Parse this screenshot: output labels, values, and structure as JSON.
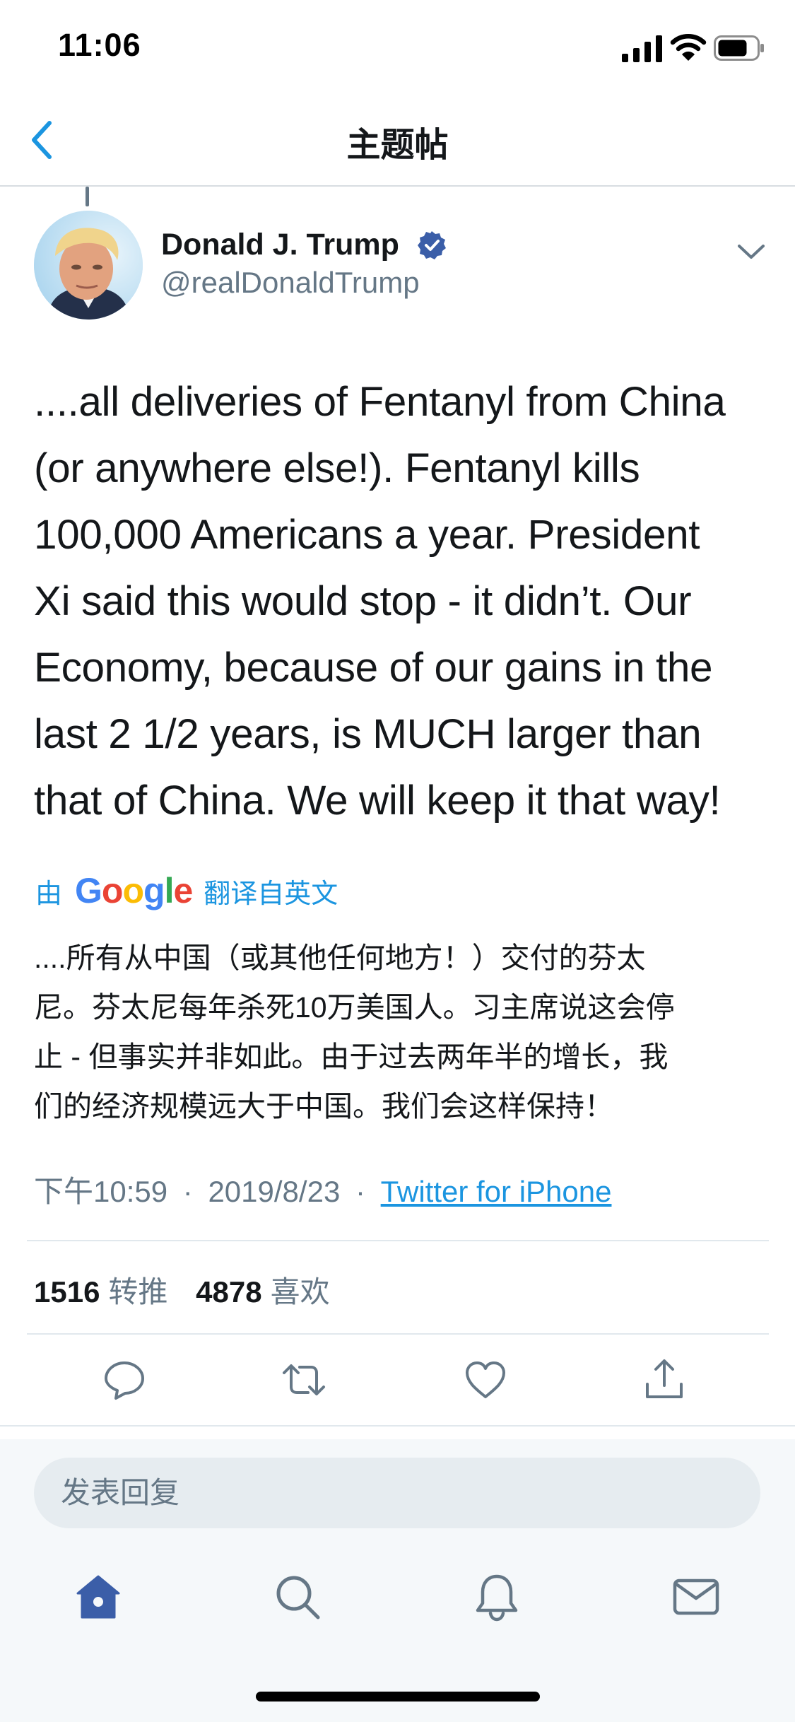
{
  "status_bar": {
    "time": "11:06"
  },
  "nav": {
    "title": "主题帖"
  },
  "author": {
    "name": "Donald J. Trump",
    "handle": "@realDonaldTrump"
  },
  "tweet": {
    "text_lines": [
      "....all deliveries of Fentanyl from China",
      "(or anywhere else!). Fentanyl kills",
      "100,000 Americans a year. President",
      "Xi said this would stop - it didn’t. Our",
      "Economy, because of our gains in the",
      "last 2 1/2 years, is MUCH larger than",
      "that of China. We will keep it that way!"
    ]
  },
  "translation": {
    "prefix": "由",
    "provider": "Google",
    "suffix": "翻译自英文",
    "text_lines": [
      "....所有从中国（或其他任何地方！）交付的芬太",
      "尼。芬太尼每年杀死10万美国人。习主席说这会停",
      "止 - 但事实并非如此。由于过去两年半的增长，我",
      "们的经济规模远大于中国。我们会这样保持！"
    ]
  },
  "meta": {
    "time": "下午10:59",
    "separator": "·",
    "date": "2019/8/23",
    "source": "Twitter for iPhone"
  },
  "stats": {
    "retweets_count": "1516",
    "retweets_label": "转推",
    "likes_count": "4878",
    "likes_label": "喜欢"
  },
  "composer": {
    "placeholder": "发表回复"
  },
  "icons": {
    "back": "chevron-left-icon",
    "verified": "verified-badge-icon",
    "more": "chevron-down-icon",
    "reply": "reply-icon",
    "retweet": "retweet-icon",
    "like": "heart-icon",
    "share": "share-icon",
    "tabs": [
      "home-icon",
      "search-icon",
      "bell-icon",
      "mail-icon"
    ]
  },
  "colors": {
    "accent": "#1da1f2",
    "link": "#1b95e0",
    "text_primary": "#14171a",
    "text_secondary": "#657786",
    "divider": "#e1e8ed",
    "home_tab_active": "#3b5ea8"
  }
}
